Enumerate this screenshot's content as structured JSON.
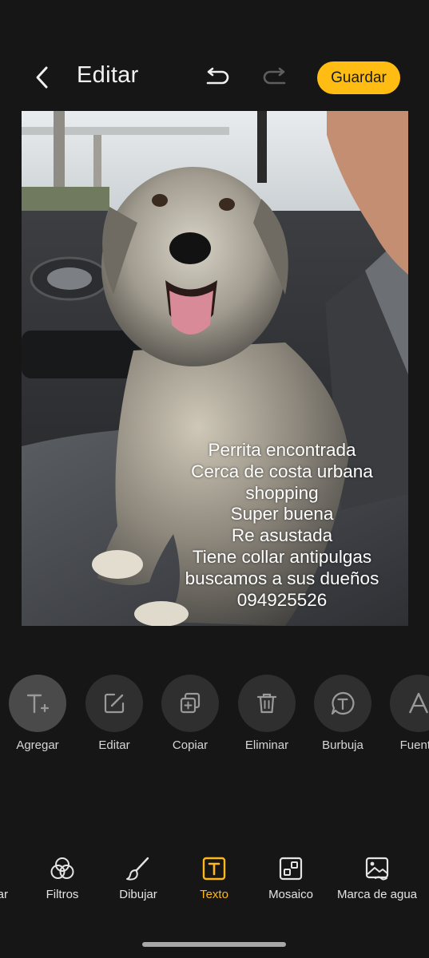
{
  "header": {
    "title": "Editar",
    "save_label": "Guardar",
    "accent": "#ffbd13"
  },
  "photo": {
    "caption_lines": [
      "Perrita encontrada",
      "Cerca de costa urbana",
      "shopping",
      "Super buena",
      "Re asustada",
      "Tiene collar antipulgas",
      "buscamos a sus dueños",
      "094925526"
    ]
  },
  "tools": [
    {
      "label": "Agregar",
      "icon": "add-text-icon"
    },
    {
      "label": "Editar",
      "icon": "edit-icon"
    },
    {
      "label": "Copiar",
      "icon": "copy-icon"
    },
    {
      "label": "Eliminar",
      "icon": "trash-icon"
    },
    {
      "label": "Burbuja",
      "icon": "bubble-icon"
    },
    {
      "label": "Fuente",
      "icon": "font-icon"
    }
  ],
  "nav": {
    "items": [
      {
        "label": "Ajustar",
        "icon": "adjust-icon"
      },
      {
        "label": "Filtros",
        "icon": "filters-icon"
      },
      {
        "label": "Dibujar",
        "icon": "brush-icon"
      },
      {
        "label": "Texto",
        "icon": "text-icon"
      },
      {
        "label": "Mosaico",
        "icon": "mosaic-icon"
      },
      {
        "label": "Marca de agua",
        "icon": "watermark-icon"
      }
    ],
    "active": "Texto",
    "active_color": "#ffb81c"
  }
}
